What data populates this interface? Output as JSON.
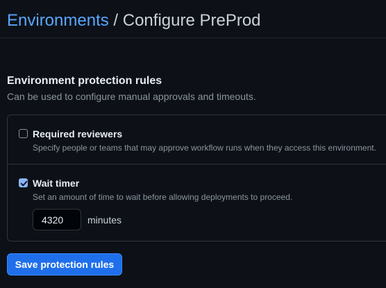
{
  "header": {
    "breadcrumb_link": "Environments",
    "separator": " / ",
    "title": "Configure PreProd"
  },
  "section": {
    "title": "Environment protection rules",
    "description": "Can be used to configure manual approvals and timeouts."
  },
  "rules": {
    "required_reviewers": {
      "label": "Required reviewers",
      "description": "Specify people or teams that may approve workflow runs when they access this environment.",
      "checked": false
    },
    "wait_timer": {
      "label": "Wait timer",
      "description": "Set an amount of time to wait before allowing deployments to proceed.",
      "checked": true,
      "value": "4320",
      "unit": "minutes"
    }
  },
  "actions": {
    "save_label": "Save protection rules"
  },
  "colors": {
    "background": "#0d1117",
    "link": "#58a6ff",
    "primary_button": "#1f6feb",
    "checkbox_checked": "#8ab4f8"
  }
}
